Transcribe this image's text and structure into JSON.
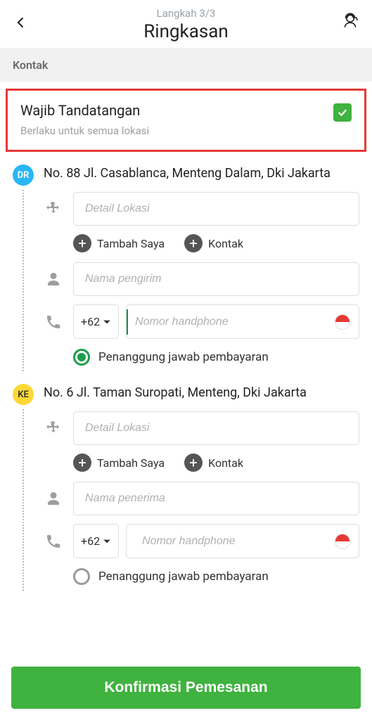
{
  "header": {
    "step_label": "Langkah 3/3",
    "page_title": "Ringkasan"
  },
  "section": {
    "contact_label": "Kontak"
  },
  "signature": {
    "title": "Wajib Tandatangan",
    "subtitle": "Berlaku untuk semua lokasi",
    "checked": true
  },
  "locations": [
    {
      "marker": "DR",
      "marker_color": "blue",
      "address": "No. 88 Jl. Casablanca, Menteng Dalam, Dki Jakarta",
      "detail_placeholder": "Detail Lokasi",
      "add_self_label": "Tambah Saya",
      "add_contact_label": "Kontak",
      "name_placeholder": "Nama pengirim",
      "country_code": "+62",
      "phone_placeholder": "Nomor handphone",
      "payer_label": "Penanggung jawab pembayaran",
      "payer_selected": true
    },
    {
      "marker": "KE",
      "marker_color": "yellow",
      "address": "No. 6 Jl. Taman Suropati, Menteng, Dki Jakarta",
      "detail_placeholder": "Detail Lokasi",
      "add_self_label": "Tambah Saya",
      "add_contact_label": "Kontak",
      "name_placeholder": "Nama penerima",
      "country_code": "+62",
      "phone_placeholder": "Nomor handphone",
      "payer_label": "Penanggung jawab pembayaran",
      "payer_selected": false
    }
  ],
  "footer": {
    "confirm_label": "Konfirmasi Pemesanan"
  }
}
